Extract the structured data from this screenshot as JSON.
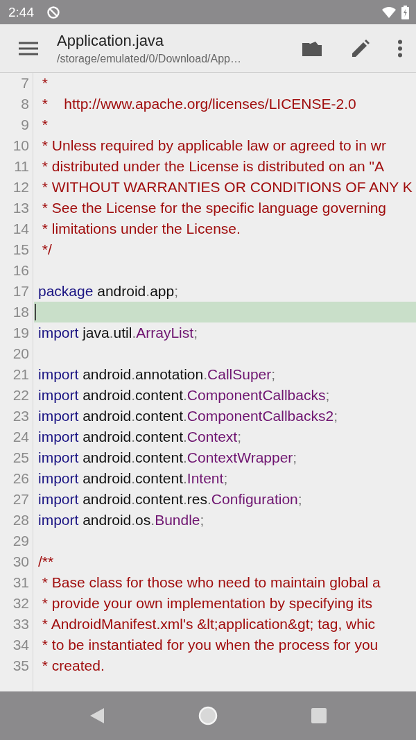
{
  "status_bar": {
    "time": "2:44"
  },
  "app_bar": {
    "title": "Application.java",
    "subtitle": "/storage/emulated/0/Download/App…"
  },
  "editor": {
    "lines": [
      {
        "number": "7",
        "current": false,
        "tokens": [
          {
            "kind": "comment",
            "text": " *"
          }
        ]
      },
      {
        "number": "8",
        "current": false,
        "tokens": [
          {
            "kind": "comment",
            "text": " *    http://www.apache.org/licenses/LICENSE-2.0"
          }
        ]
      },
      {
        "number": "9",
        "current": false,
        "tokens": [
          {
            "kind": "comment",
            "text": " *"
          }
        ]
      },
      {
        "number": "10",
        "current": false,
        "tokens": [
          {
            "kind": "comment",
            "text": " * Unless required by applicable law or agreed to in wr"
          }
        ]
      },
      {
        "number": "11",
        "current": false,
        "tokens": [
          {
            "kind": "comment",
            "text": " * distributed under the License is distributed on an \"A"
          }
        ]
      },
      {
        "number": "12",
        "current": false,
        "tokens": [
          {
            "kind": "comment",
            "text": " * WITHOUT WARRANTIES OR CONDITIONS OF ANY K"
          }
        ]
      },
      {
        "number": "13",
        "current": false,
        "tokens": [
          {
            "kind": "comment",
            "text": " * See the License for the specific language governing"
          }
        ]
      },
      {
        "number": "14",
        "current": false,
        "tokens": [
          {
            "kind": "comment",
            "text": " * limitations under the License."
          }
        ]
      },
      {
        "number": "15",
        "current": false,
        "tokens": [
          {
            "kind": "comment",
            "text": " */"
          }
        ]
      },
      {
        "number": "16",
        "current": false
      },
      {
        "number": "17",
        "current": false,
        "tokens": [
          {
            "kind": "keyword",
            "text": "package"
          },
          {
            "kind": "plain",
            "text": " android"
          },
          {
            "kind": "punct",
            "text": "."
          },
          {
            "kind": "plain",
            "text": "app"
          },
          {
            "kind": "punct",
            "text": ";"
          }
        ]
      },
      {
        "number": "18",
        "current": true
      },
      {
        "number": "19",
        "current": false,
        "tokens": [
          {
            "kind": "keyword",
            "text": "import"
          },
          {
            "kind": "plain",
            "text": " java"
          },
          {
            "kind": "punct",
            "text": "."
          },
          {
            "kind": "plain",
            "text": "util"
          },
          {
            "kind": "punct",
            "text": "."
          },
          {
            "kind": "type",
            "text": "ArrayList"
          },
          {
            "kind": "punct",
            "text": ";"
          }
        ]
      },
      {
        "number": "20",
        "current": false
      },
      {
        "number": "21",
        "current": false,
        "tokens": [
          {
            "kind": "keyword",
            "text": "import"
          },
          {
            "kind": "plain",
            "text": " android"
          },
          {
            "kind": "punct",
            "text": "."
          },
          {
            "kind": "plain",
            "text": "annotation"
          },
          {
            "kind": "punct",
            "text": "."
          },
          {
            "kind": "type",
            "text": "CallSuper"
          },
          {
            "kind": "punct",
            "text": ";"
          }
        ]
      },
      {
        "number": "22",
        "current": false,
        "tokens": [
          {
            "kind": "keyword",
            "text": "import"
          },
          {
            "kind": "plain",
            "text": " android"
          },
          {
            "kind": "punct",
            "text": "."
          },
          {
            "kind": "plain",
            "text": "content"
          },
          {
            "kind": "punct",
            "text": "."
          },
          {
            "kind": "type",
            "text": "ComponentCallbacks"
          },
          {
            "kind": "punct",
            "text": ";"
          }
        ]
      },
      {
        "number": "23",
        "current": false,
        "tokens": [
          {
            "kind": "keyword",
            "text": "import"
          },
          {
            "kind": "plain",
            "text": " android"
          },
          {
            "kind": "punct",
            "text": "."
          },
          {
            "kind": "plain",
            "text": "content"
          },
          {
            "kind": "punct",
            "text": "."
          },
          {
            "kind": "type",
            "text": "ComponentCallbacks2"
          },
          {
            "kind": "punct",
            "text": ";"
          }
        ]
      },
      {
        "number": "24",
        "current": false,
        "tokens": [
          {
            "kind": "keyword",
            "text": "import"
          },
          {
            "kind": "plain",
            "text": " android"
          },
          {
            "kind": "punct",
            "text": "."
          },
          {
            "kind": "plain",
            "text": "content"
          },
          {
            "kind": "punct",
            "text": "."
          },
          {
            "kind": "type",
            "text": "Context"
          },
          {
            "kind": "punct",
            "text": ";"
          }
        ]
      },
      {
        "number": "25",
        "current": false,
        "tokens": [
          {
            "kind": "keyword",
            "text": "import"
          },
          {
            "kind": "plain",
            "text": " android"
          },
          {
            "kind": "punct",
            "text": "."
          },
          {
            "kind": "plain",
            "text": "content"
          },
          {
            "kind": "punct",
            "text": "."
          },
          {
            "kind": "type",
            "text": "ContextWrapper"
          },
          {
            "kind": "punct",
            "text": ";"
          }
        ]
      },
      {
        "number": "26",
        "current": false,
        "tokens": [
          {
            "kind": "keyword",
            "text": "import"
          },
          {
            "kind": "plain",
            "text": " android"
          },
          {
            "kind": "punct",
            "text": "."
          },
          {
            "kind": "plain",
            "text": "content"
          },
          {
            "kind": "punct",
            "text": "."
          },
          {
            "kind": "type",
            "text": "Intent"
          },
          {
            "kind": "punct",
            "text": ";"
          }
        ]
      },
      {
        "number": "27",
        "current": false,
        "tokens": [
          {
            "kind": "keyword",
            "text": "import"
          },
          {
            "kind": "plain",
            "text": " android"
          },
          {
            "kind": "punct",
            "text": "."
          },
          {
            "kind": "plain",
            "text": "content"
          },
          {
            "kind": "punct",
            "text": "."
          },
          {
            "kind": "plain",
            "text": "res"
          },
          {
            "kind": "punct",
            "text": "."
          },
          {
            "kind": "type",
            "text": "Configuration"
          },
          {
            "kind": "punct",
            "text": ";"
          }
        ]
      },
      {
        "number": "28",
        "current": false,
        "tokens": [
          {
            "kind": "keyword",
            "text": "import"
          },
          {
            "kind": "plain",
            "text": " android"
          },
          {
            "kind": "punct",
            "text": "."
          },
          {
            "kind": "plain",
            "text": "os"
          },
          {
            "kind": "punct",
            "text": "."
          },
          {
            "kind": "type",
            "text": "Bundle"
          },
          {
            "kind": "punct",
            "text": ";"
          }
        ]
      },
      {
        "number": "29",
        "current": false
      },
      {
        "number": "30",
        "current": false,
        "tokens": [
          {
            "kind": "comment",
            "text": "/**"
          }
        ]
      },
      {
        "number": "31",
        "current": false,
        "tokens": [
          {
            "kind": "comment",
            "text": " * Base class for those who need to maintain global a"
          }
        ]
      },
      {
        "number": "32",
        "current": false,
        "tokens": [
          {
            "kind": "comment",
            "text": " * provide your own implementation by specifying its"
          }
        ]
      },
      {
        "number": "33",
        "current": false,
        "tokens": [
          {
            "kind": "comment",
            "text": " * AndroidManifest.xml's &lt;application&gt; tag, whic"
          }
        ]
      },
      {
        "number": "34",
        "current": false,
        "tokens": [
          {
            "kind": "comment",
            "text": " * to be instantiated for you when the process for you"
          }
        ]
      },
      {
        "number": "35",
        "current": false,
        "tokens": [
          {
            "kind": "comment",
            "text": " * created."
          }
        ]
      }
    ]
  }
}
